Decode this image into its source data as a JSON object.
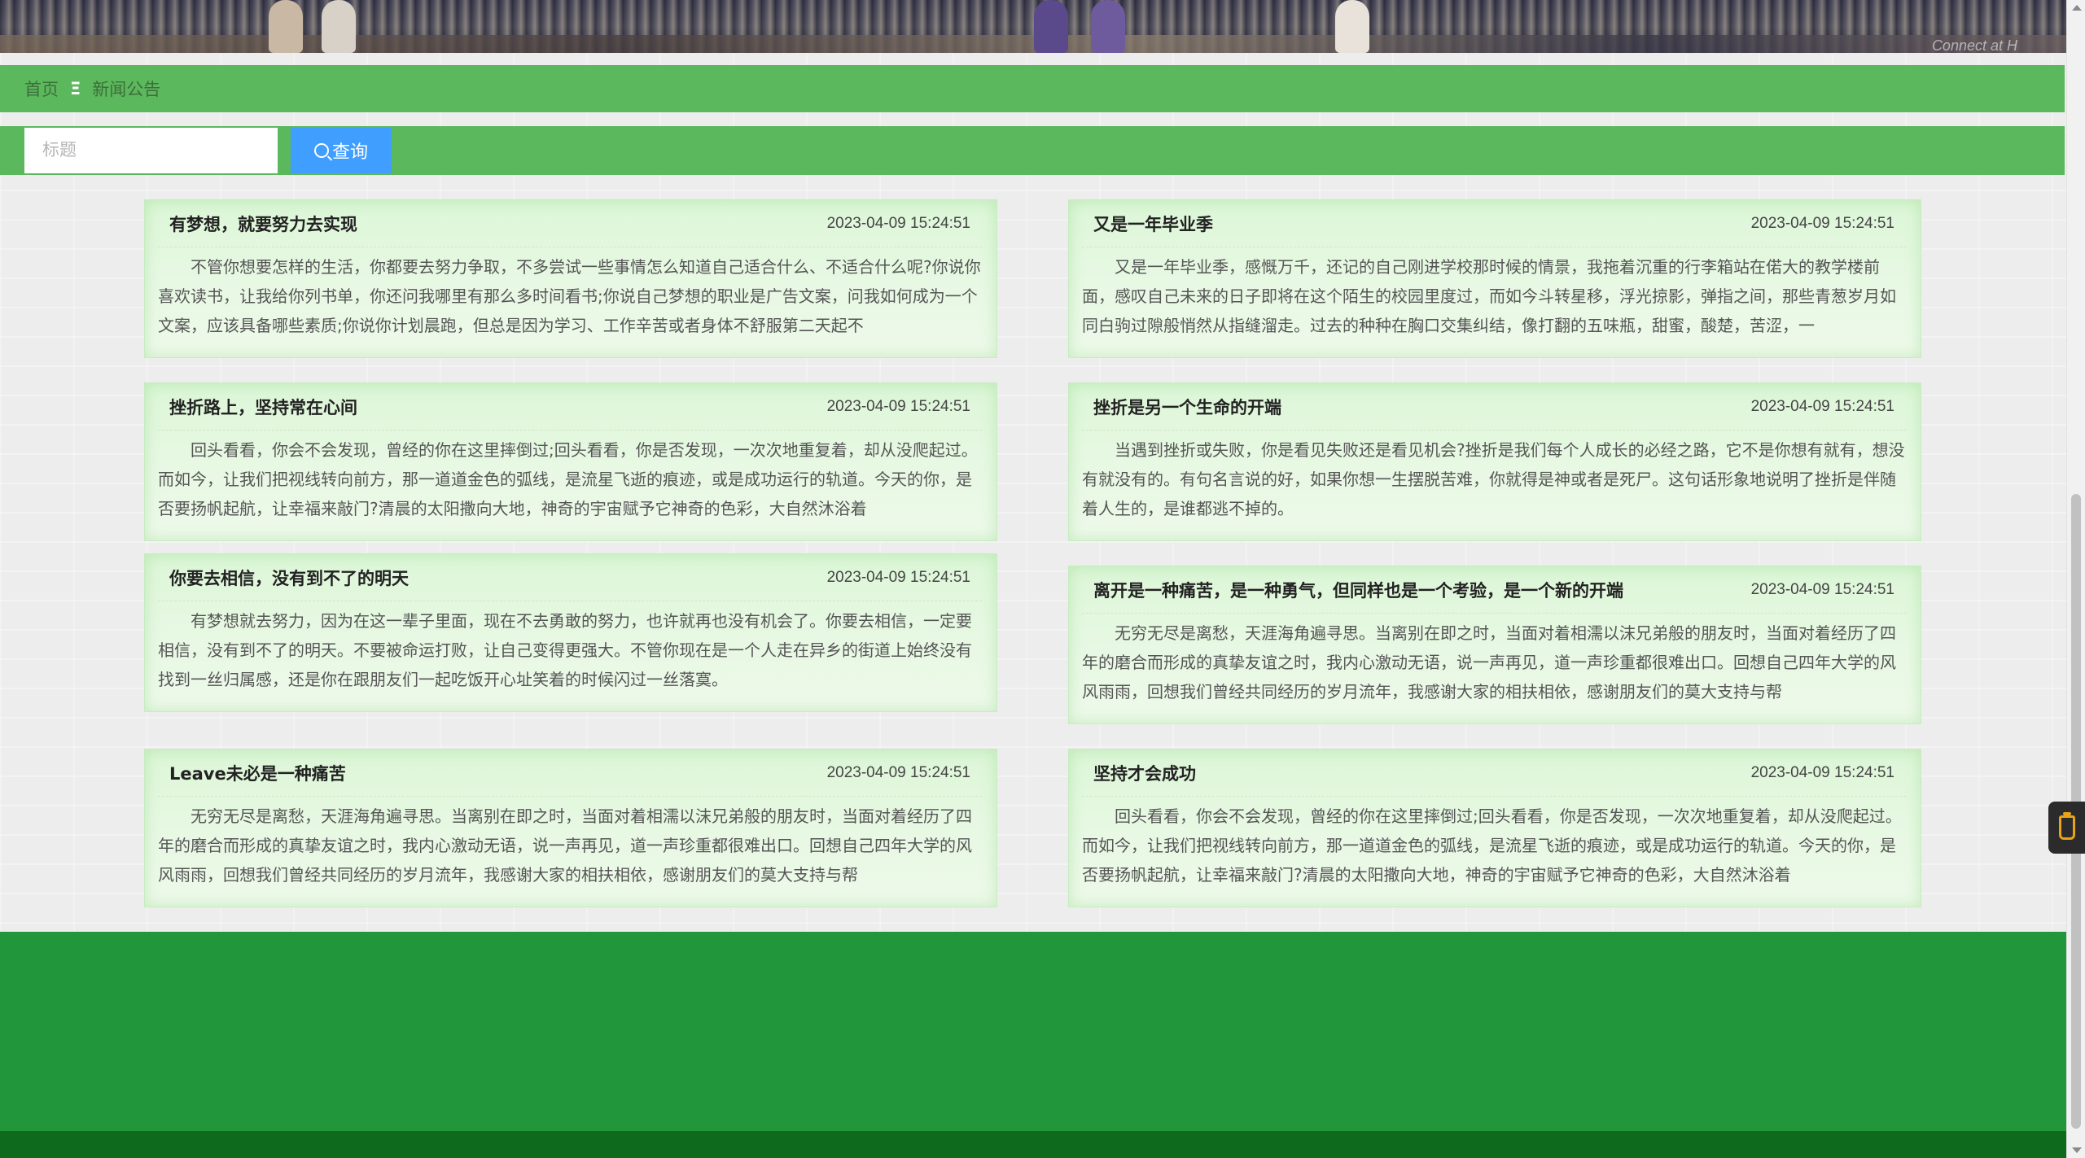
{
  "banner": {
    "caption": "Connect at H"
  },
  "breadcrumb": {
    "home": "首页",
    "separator": "Ξ",
    "current": "新闻公告"
  },
  "search": {
    "placeholder": "标题",
    "value": "",
    "button_label": "查询",
    "button_icon": "search-icon"
  },
  "news": [
    {
      "title": "有梦想，就要努力去实现",
      "time": "2023-04-09 15:24:51",
      "excerpt": "不管你想要怎样的生活，你都要去努力争取，不多尝试一些事情怎么知道自己适合什么、不适合什么呢?你说你喜欢读书，让我给你列书单，你还问我哪里有那么多时间看书;你说自己梦想的职业是广告文案，问我如何成为一个文案，应该具备哪些素质;你说你计划晨跑，但总是因为学习、工作辛苦或者身体不舒服第二天起不"
    },
    {
      "title": "又是一年毕业季",
      "time": "2023-04-09 15:24:51",
      "excerpt": "又是一年毕业季，感慨万千，还记的自己刚进学校那时候的情景，我拖着沉重的行李箱站在偌大的教学楼前面，感叹自己未来的日子即将在这个陌生的校园里度过，而如今斗转星移，浮光掠影，弹指之间，那些青葱岁月如同白驹过隙般悄然从指缝溜走。过去的种种在胸口交集纠结，像打翻的五味瓶，甜蜜，酸楚，苦涩，一"
    },
    {
      "title": "挫折路上，坚持常在心间",
      "time": "2023-04-09 15:24:51",
      "excerpt": "回头看看，你会不会发现，曾经的你在这里摔倒过;回头看看，你是否发现，一次次地重复着，却从没爬起过。而如今，让我们把视线转向前方，那一道道金色的弧线，是流星飞逝的痕迹，或是成功运行的轨道。今天的你，是否要扬帆起航，让幸福来敲门?清晨的太阳撒向大地，神奇的宇宙赋予它神奇的色彩，大自然沐浴着"
    },
    {
      "title": "挫折是另一个生命的开端",
      "time": "2023-04-09 15:24:51",
      "excerpt": "当遇到挫折或失败，你是看见失败还是看见机会?挫折是我们每个人成长的必经之路，它不是你想有就有，想没有就没有的。有句名言说的好，如果你想一生摆脱苦难，你就得是神或者是死尸。这句话形象地说明了挫折是伴随着人生的，是谁都逃不掉的。"
    },
    {
      "title": "你要去相信，没有到不了的明天",
      "time": "2023-04-09 15:24:51",
      "excerpt": "有梦想就去努力，因为在这一辈子里面，现在不去勇敢的努力，也许就再也没有机会了。你要去相信，一定要相信，没有到不了的明天。不要被命运打败，让自己变得更强大。不管你现在是一个人走在异乡的街道上始终没有找到一丝归属感，还是你在跟朋友们一起吃饭开心址笑着的时候闪过一丝落寞。"
    },
    {
      "title": "离开是一种痛苦，是一种勇气，但同样也是一个考验，是一个新的开端",
      "time": "2023-04-09 15:24:51",
      "excerpt": "无穷无尽是离愁，天涯海角遍寻思。当离别在即之时，当面对着相濡以沫兄弟般的朋友时，当面对着经历了四年的磨合而形成的真挚友谊之时，我内心激动无语，说一声再见，道一声珍重都很难出口。回想自己四年大学的风风雨雨，回想我们曾经共同经历的岁月流年，我感谢大家的相扶相依，感谢朋友们的莫大支持与帮"
    },
    {
      "title": "Leave未必是一种痛苦",
      "time": "2023-04-09 15:24:51",
      "excerpt": "无穷无尽是离愁，天涯海角遍寻思。当离别在即之时，当面对着相濡以沫兄弟般的朋友时，当面对着经历了四年的磨合而形成的真挚友谊之时，我内心激动无语，说一声再见，道一声珍重都很难出口。回想自己四年大学的风风雨雨，回想我们曾经共同经历的岁月流年，我感谢大家的相扶相依，感谢朋友们的莫大支持与帮"
    },
    {
      "title": "坚持才会成功",
      "time": "2023-04-09 15:24:51",
      "excerpt": "回头看看，你会不会发现，曾经的你在这里摔倒过;回头看看，你是否发现，一次次地重复着，却从没爬起过。而如今，让我们把视线转向前方，那一道道金色的弧线，是流星飞逝的痕迹，或是成功运行的轨道。今天的你，是否要扬帆起航，让幸福来敲门?清晨的太阳撒向大地，神奇的宇宙赋予它神奇的色彩，大自然沐浴着"
    }
  ],
  "colors": {
    "nav_green": "#5cb85c",
    "button_blue": "#409eff",
    "footer_green": "#21963a",
    "footer_dark": "#0e6a1c"
  },
  "side_widget": {
    "icon": "cup-icon"
  }
}
